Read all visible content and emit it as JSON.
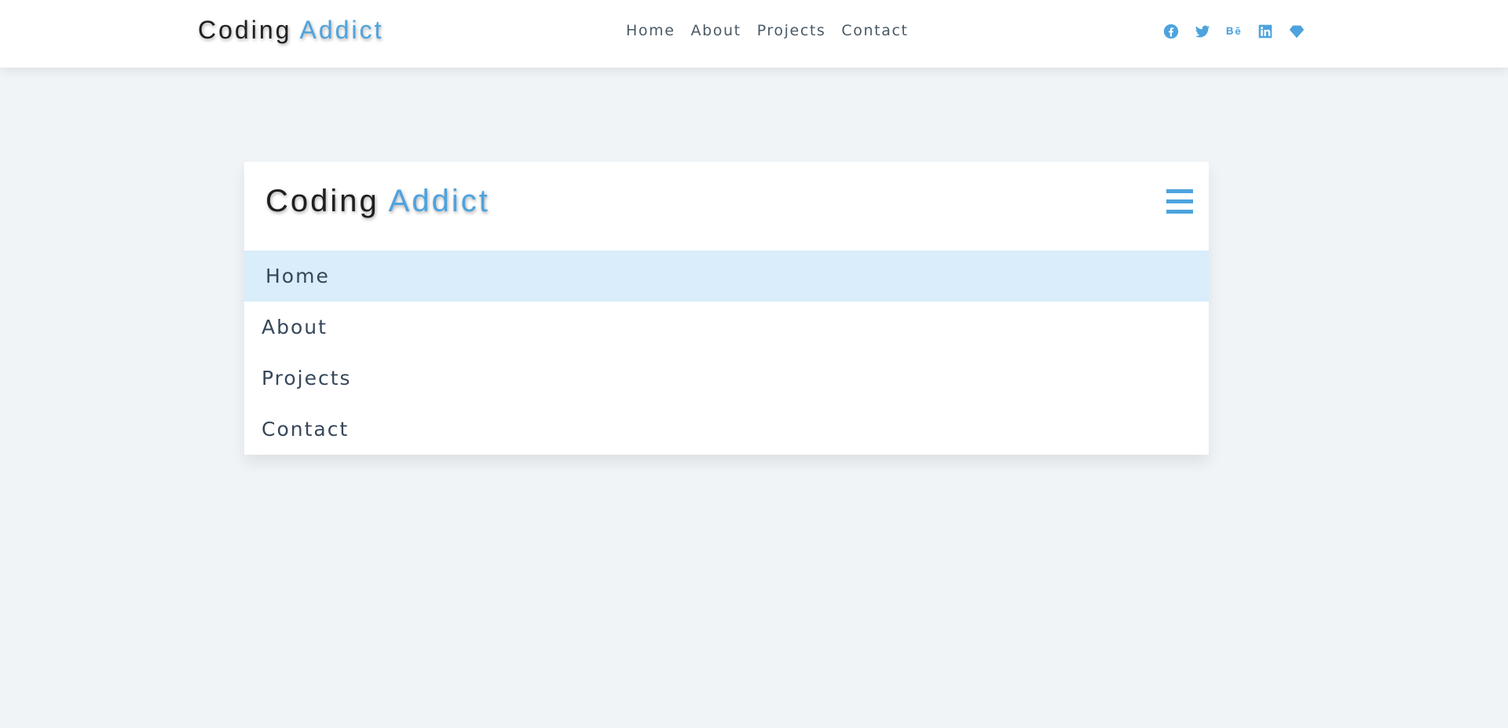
{
  "brand": {
    "word1": "Coding",
    "word2": "Addict"
  },
  "nav": {
    "items": [
      "Home",
      "About",
      "Projects",
      "Contact"
    ]
  },
  "social": {
    "icons": [
      "facebook-icon",
      "twitter-icon",
      "behance-icon",
      "linkedin-icon",
      "sketch-icon"
    ]
  },
  "card": {
    "brand": {
      "word1": "Coding",
      "word2": "Addict"
    },
    "menu": {
      "items": [
        "Home",
        "About",
        "Projects",
        "Contact"
      ],
      "active_index": 0
    }
  },
  "colors": {
    "accent": "#4da3de",
    "background": "#f0f4f7",
    "active_bg": "#d9edfa",
    "text": "#36475a"
  }
}
